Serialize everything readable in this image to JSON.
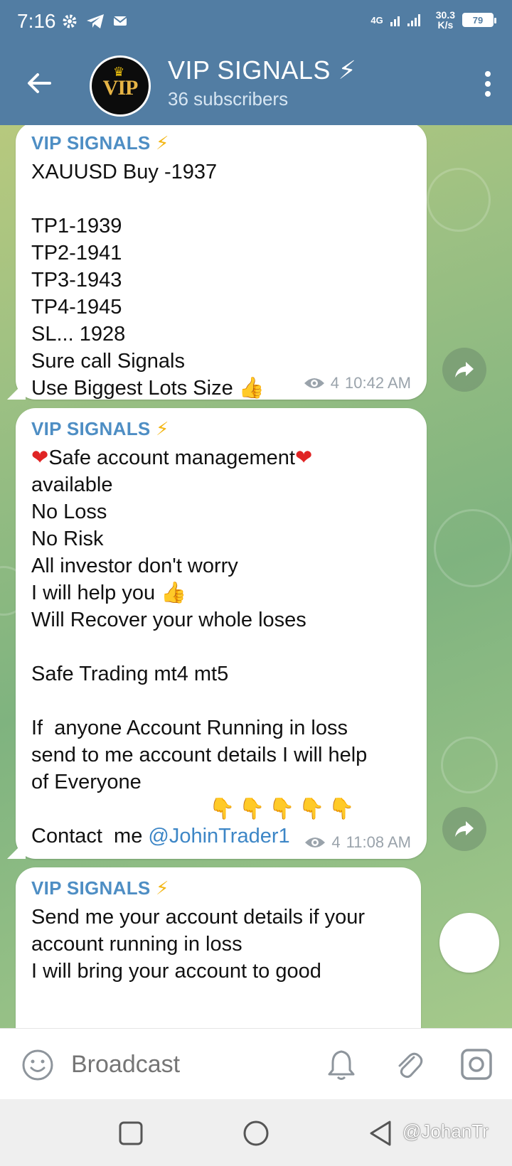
{
  "status_bar": {
    "time": "7:16",
    "network": "4G",
    "speed_value": "30.3",
    "speed_unit": "K/s",
    "battery": "79"
  },
  "header": {
    "avatar_text": "VIP",
    "channel_name": "VIP SIGNALS ⚡",
    "subscribers": "36 subscribers"
  },
  "messages": [
    {
      "sender": "VIP SIGNALS",
      "lines": [
        "XAUUSD Buy -1937",
        "",
        "TP1-1939",
        "TP2-1941",
        "TP3-1943",
        "TP4-1945",
        "SL... 1928",
        "Sure call Signals",
        "Use Biggest Lots Size"
      ],
      "views": "4",
      "time": "10:42 AM"
    },
    {
      "sender": "VIP SIGNALS",
      "lines": [
        "Safe account management",
        "available",
        "No Loss",
        "No Risk",
        "All investor don't worry",
        "I will help you",
        "Will Recover your whole loses",
        "",
        "Safe Trading mt4 mt5",
        "",
        "If  anyone Account Running in loss",
        "send to me account details I will help",
        "of Everyone",
        "",
        "Contact  me "
      ],
      "link": "@JohinTrader1",
      "views": "4",
      "time": "11:08 AM"
    },
    {
      "sender": "VIP SIGNALS",
      "lines": [
        "Send me your account details if your",
        "account running in loss",
        "I will bring your account to good"
      ]
    }
  ],
  "input_bar": {
    "placeholder": "Broadcast"
  },
  "nav": {
    "watermark": "@JohanTr"
  },
  "icons": {
    "status": [
      "gear-icon",
      "telegram-icon",
      "mail-icon",
      "signal-icon",
      "battery-icon"
    ],
    "header": [
      "back-arrow-icon",
      "more-vertical-icon"
    ],
    "chat": [
      "eye-icon",
      "share-icon",
      "thumbs-up-icon",
      "heart-icon",
      "pointing-down-icon",
      "lightning-icon"
    ],
    "input": [
      "emoji-icon",
      "bell-icon",
      "paperclip-icon",
      "camera-icon"
    ]
  },
  "colors": {
    "header": "#527da3",
    "sender": "#4e8ec4",
    "link": "#3d86c6",
    "bolt": "#f3b614"
  }
}
